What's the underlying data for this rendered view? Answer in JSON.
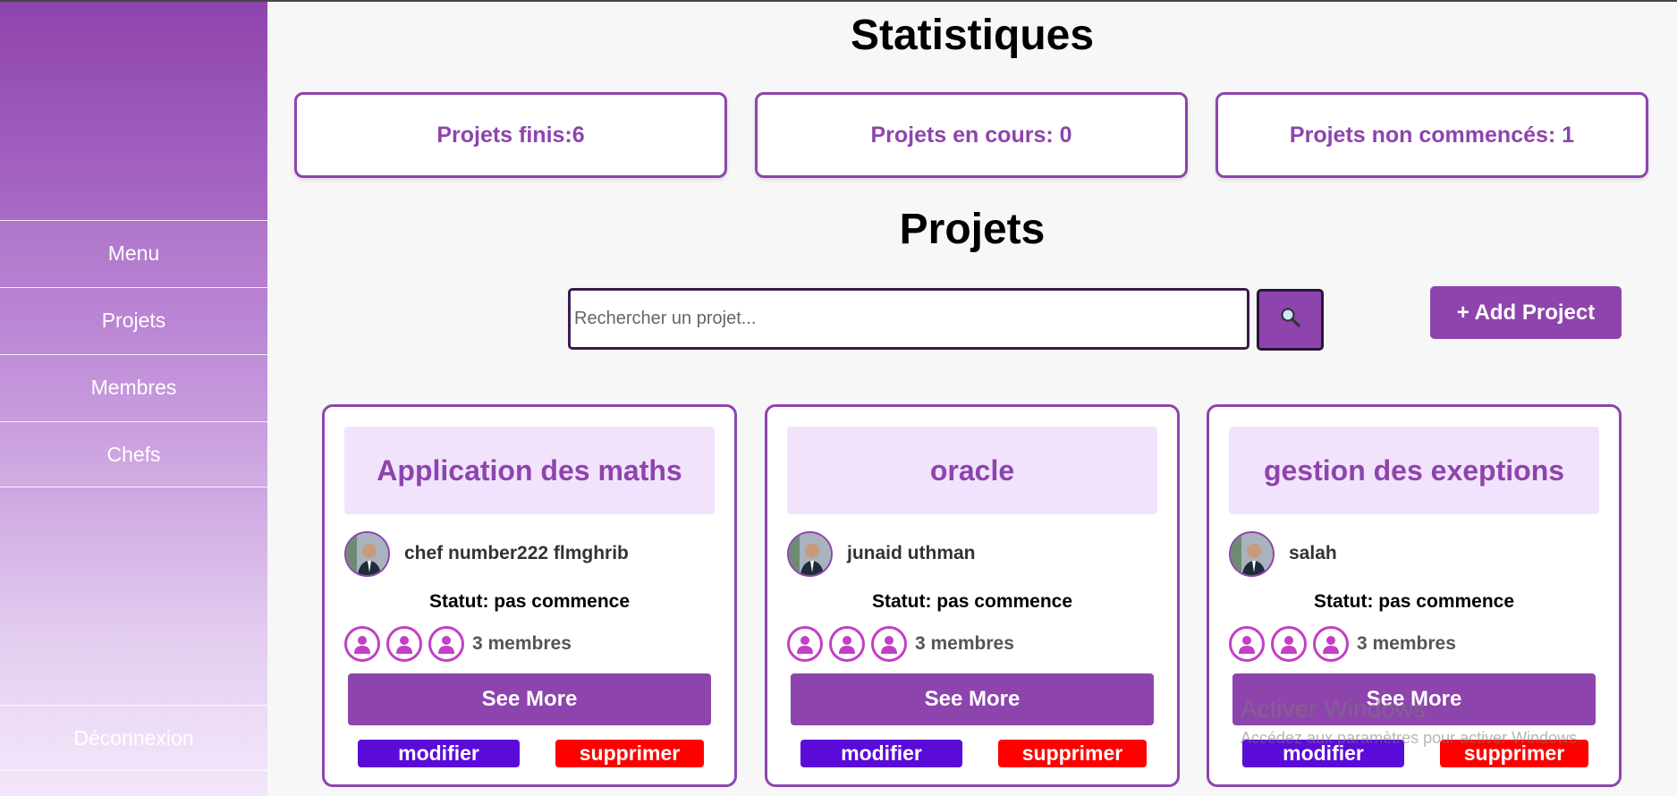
{
  "sidebar": {
    "items": [
      {
        "label": "Menu"
      },
      {
        "label": "Projets"
      },
      {
        "label": "Membres"
      },
      {
        "label": "Chefs"
      }
    ],
    "logout_label": "Déconnexion"
  },
  "stats": {
    "title": "Statistiques",
    "finished": "Projets finis:6",
    "in_progress": "Projets en cours: 0",
    "not_started": "Projets non commencés: 1"
  },
  "projects": {
    "title": "Projets",
    "search_placeholder": "Rechercher un projet...",
    "add_label": "+ Add Project",
    "cards": [
      {
        "title": "Application des maths",
        "chef": "chef number222 flmghrib",
        "status": "Statut: pas commence",
        "members": "3 membres",
        "see_more": "See More",
        "modify": "modifier",
        "delete": "supprimer"
      },
      {
        "title": "oracle",
        "chef": "junaid uthman",
        "status": "Statut: pas commence",
        "members": "3 membres",
        "see_more": "See More",
        "modify": "modifier",
        "delete": "supprimer"
      },
      {
        "title": "gestion des exeptions",
        "chef": "salah",
        "status": "Statut: pas commence",
        "members": "3 membres",
        "see_more": "See More",
        "modify": "modifier",
        "delete": "supprimer"
      }
    ]
  },
  "watermark": {
    "title": "Activer Windows",
    "subtitle": "Accédez aux paramètres pour activer Windows."
  },
  "colors": {
    "accent": "#8e44ad",
    "modify": "#5b0bd8",
    "delete": "#ff0000",
    "card_title_bg": "#f2e3fc"
  }
}
